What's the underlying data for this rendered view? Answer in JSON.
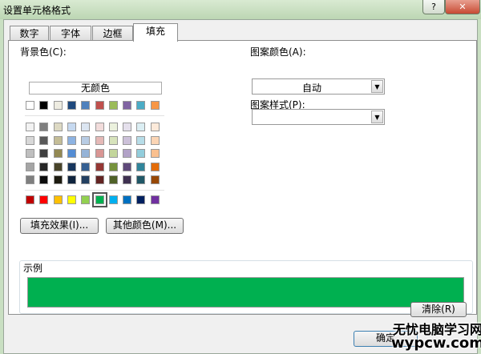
{
  "window": {
    "title": "设置单元格格式",
    "help": "?",
    "close": "✕"
  },
  "tabs": [
    {
      "label": "数字"
    },
    {
      "label": "字体"
    },
    {
      "label": "边框"
    },
    {
      "label": "填充",
      "active": true
    }
  ],
  "background": {
    "label": "背景色(C):",
    "no_color": "无颜色",
    "theme_row": [
      "#FFFFFF",
      "#000000",
      "#EEECE1",
      "#1F497D",
      "#4F81BD",
      "#C0504D",
      "#9BBB59",
      "#8064A2",
      "#4BACC6",
      "#F79646"
    ],
    "tint_rows": [
      [
        "#F2F2F2",
        "#7F7F7F",
        "#DDD9C3",
        "#C6D9F0",
        "#DBE5F1",
        "#F2DCDB",
        "#EBF1DD",
        "#E5E0EC",
        "#DBEEF3",
        "#FDEADA"
      ],
      [
        "#D8D8D8",
        "#595959",
        "#C4BD97",
        "#8DB3E2",
        "#B8CCE4",
        "#E5B9B7",
        "#D7E3BC",
        "#CCC1D9",
        "#B7DDE8",
        "#FBD5B5"
      ],
      [
        "#BFBFBF",
        "#3F3F3F",
        "#938953",
        "#548DD4",
        "#95B3D7",
        "#D99694",
        "#C3D69B",
        "#B2A2C7",
        "#92CDDC",
        "#FAC08F"
      ],
      [
        "#A5A5A5",
        "#262626",
        "#494429",
        "#17365D",
        "#366092",
        "#953734",
        "#76923C",
        "#5F497A",
        "#31859B",
        "#E36C09"
      ],
      [
        "#7F7F7F",
        "#0C0C0C",
        "#1D1B10",
        "#0F243E",
        "#244061",
        "#632423",
        "#4F6128",
        "#3F3151",
        "#205867",
        "#974806"
      ]
    ],
    "standard_row": [
      "#C00000",
      "#FF0000",
      "#FFC000",
      "#FFFF00",
      "#92D050",
      "#00B050",
      "#00B0F0",
      "#0070C0",
      "#002060",
      "#7030A0"
    ],
    "selected": "#00B050",
    "fill_effects": "填充效果(I)...",
    "more_colors": "其他颜色(M)..."
  },
  "pattern": {
    "color_label": "图案颜色(A):",
    "color_value": "自动",
    "style_label": "图案样式(P):",
    "style_value": ""
  },
  "sample": {
    "label": "示例",
    "color": "#00B050"
  },
  "buttons": {
    "clear": "清除(R)",
    "ok": "确定"
  },
  "watermark": {
    "line1": "无忧电脑学习网",
    "line2": "wypcw.com"
  }
}
